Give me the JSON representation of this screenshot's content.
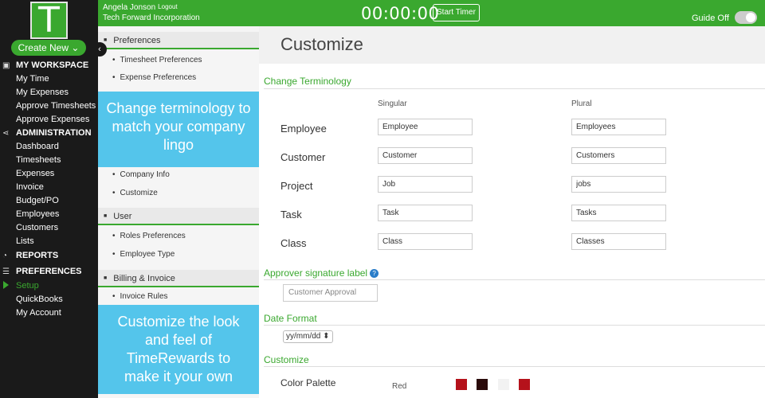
{
  "sidebar": {
    "logo_letter": "T",
    "create_new": "Create New ⌄",
    "sections": {
      "my_workspace": "MY WORKSPACE",
      "administration": "ADMINISTRATION",
      "reports": "REPORTS",
      "preferences": "PREFERENCES"
    },
    "workspace_items": [
      "My Time",
      "My Expenses",
      "Approve Timesheets",
      "Approve Expenses"
    ],
    "admin_items": [
      "Dashboard",
      "Timesheets",
      "Expenses",
      "Invoice",
      "Budget/PO",
      "Employees",
      "Customers",
      "Lists"
    ],
    "preference_items": [
      "Setup",
      "QuickBooks",
      "My Account"
    ]
  },
  "header": {
    "user_name": "Angela Jonson",
    "logout": "Logout",
    "company": "Tech Forward Incorporation",
    "timer": "00:00:00",
    "start_timer": "Start Timer",
    "guide": "Guide Off"
  },
  "settings_panel": {
    "preferences_head": "Preferences",
    "timesheet_prefs": "Timesheet Preferences",
    "expense_prefs": "Expense Preferences",
    "callout_1": "Change terminology to match your company lingo",
    "company_info": "Company Info",
    "customize": "Customize",
    "user_head": "User",
    "roles_prefs": "Roles Preferences",
    "employee_type": "Employee Type",
    "billing_head": "Billing & Invoice",
    "invoice_rules": "Invoice Rules",
    "callout_2": "Customize the look and feel of TimeRewards to make it your own"
  },
  "main": {
    "title": "Customize",
    "terminology_head": "Change Terminology",
    "col_singular": "Singular",
    "col_plural": "Plural",
    "terms": [
      {
        "label": "Employee",
        "singular": "Employee",
        "plural": "Employees"
      },
      {
        "label": "Customer",
        "singular": "Customer",
        "plural": "Customers"
      },
      {
        "label": "Project",
        "singular": "Job",
        "plural": "jobs"
      },
      {
        "label": "Task",
        "singular": "Task",
        "plural": "Tasks"
      },
      {
        "label": "Class",
        "singular": "Class",
        "plural": "Classes"
      }
    ],
    "approver_head": "Approver signature label",
    "approver_value": "Customer Approval",
    "date_head": "Date Format",
    "date_value": "yy/mm/dd ⬍",
    "customize_head": "Customize",
    "palette_label": "Color Palette",
    "palette_name": "Red",
    "palette_colors": [
      "#b5121b",
      "#2a0a0a",
      "#f2f2f2",
      "#b5121b"
    ]
  }
}
